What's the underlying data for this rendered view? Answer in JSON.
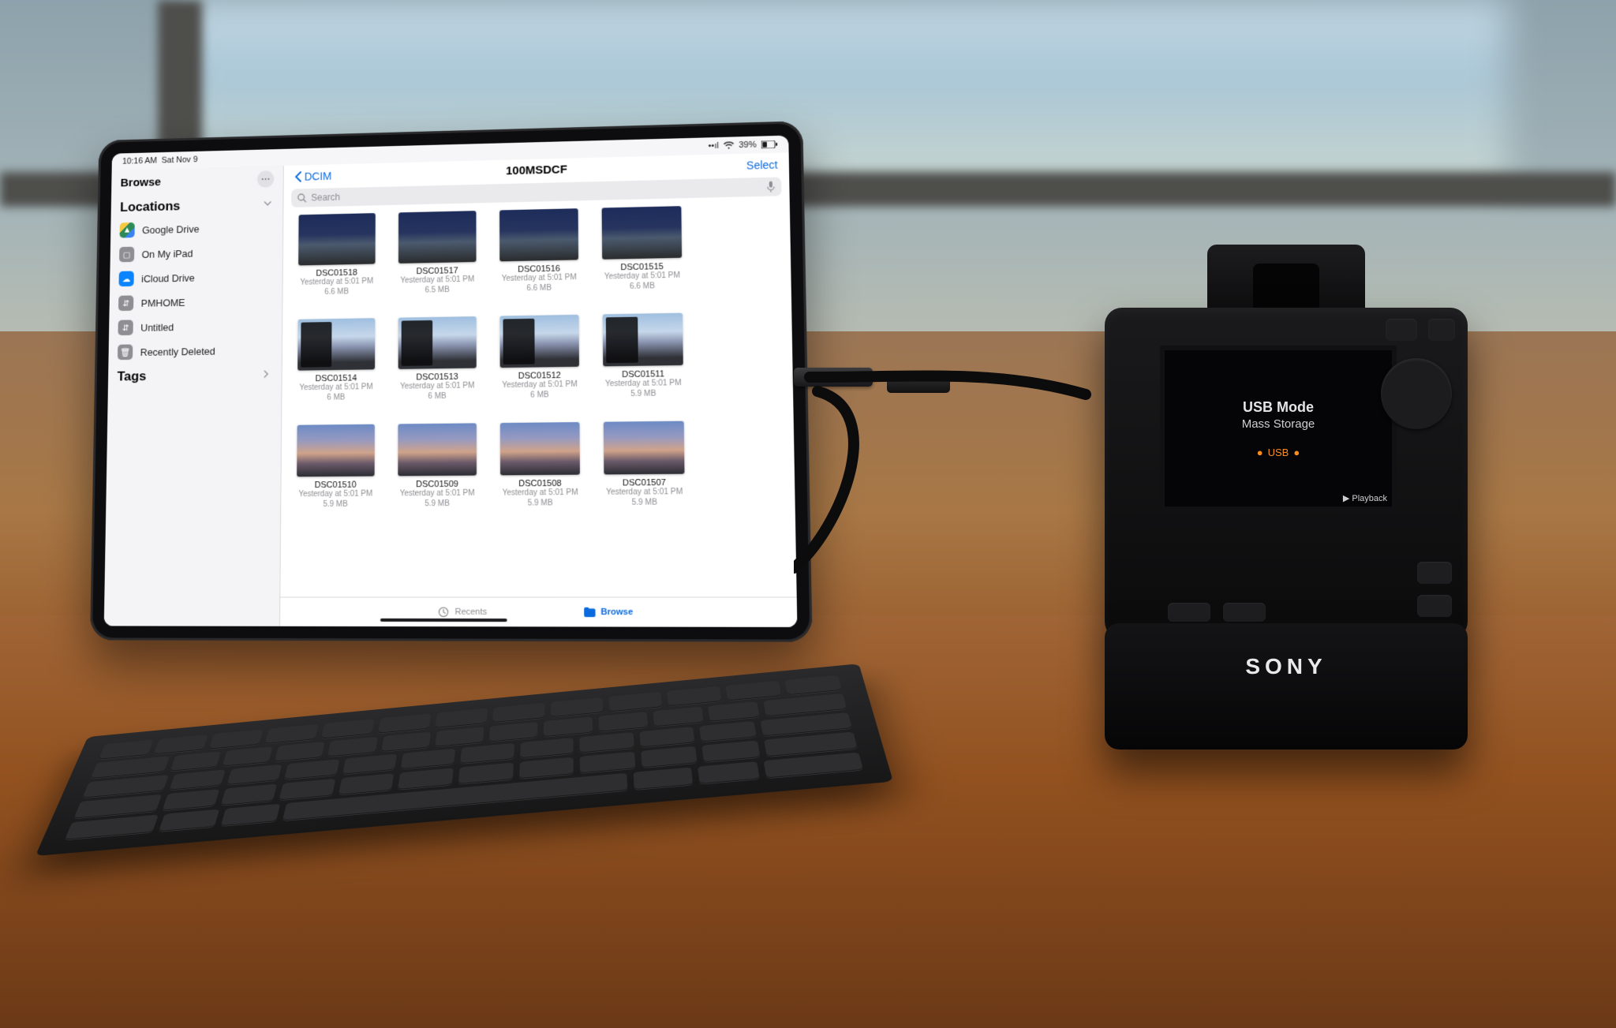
{
  "status": {
    "time": "10:16 AM",
    "date": "Sat Nov 9",
    "battery": "39%"
  },
  "sidebar": {
    "title": "Browse",
    "sections": {
      "locations": {
        "label": "Locations",
        "items": [
          {
            "label": "Google Drive"
          },
          {
            "label": "On My iPad"
          },
          {
            "label": "iCloud Drive"
          },
          {
            "label": "PMHOME"
          },
          {
            "label": "Untitled"
          },
          {
            "label": "Recently Deleted"
          }
        ]
      },
      "tags": {
        "label": "Tags"
      }
    }
  },
  "content": {
    "back_label": "DCIM",
    "title": "100MSDCF",
    "select_label": "Select",
    "search_placeholder": "Search"
  },
  "files": [
    {
      "name": "DSC01518",
      "meta1": "Yesterday at 5:01 PM",
      "meta2": "6.6 MB",
      "look": "dusk"
    },
    {
      "name": "DSC01517",
      "meta1": "Yesterday at 5:01 PM",
      "meta2": "6.5 MB",
      "look": "dusk"
    },
    {
      "name": "DSC01516",
      "meta1": "Yesterday at 5:01 PM",
      "meta2": "6.6 MB",
      "look": "dusk"
    },
    {
      "name": "DSC01515",
      "meta1": "Yesterday at 5:01 PM",
      "meta2": "6.6 MB",
      "look": "dusk"
    },
    {
      "name": "DSC01514",
      "meta1": "Yesterday at 5:01 PM",
      "meta2": "6 MB",
      "look": "dawn"
    },
    {
      "name": "DSC01513",
      "meta1": "Yesterday at 5:01 PM",
      "meta2": "6 MB",
      "look": "dawn"
    },
    {
      "name": "DSC01512",
      "meta1": "Yesterday at 5:01 PM",
      "meta2": "6 MB",
      "look": "dawn"
    },
    {
      "name": "DSC01511",
      "meta1": "Yesterday at 5:01 PM",
      "meta2": "5.9 MB",
      "look": "dawn"
    },
    {
      "name": "DSC01510",
      "meta1": "Yesterday at 5:01 PM",
      "meta2": "5.9 MB",
      "look": "eve"
    },
    {
      "name": "DSC01509",
      "meta1": "Yesterday at 5:01 PM",
      "meta2": "5.9 MB",
      "look": "eve"
    },
    {
      "name": "DSC01508",
      "meta1": "Yesterday at 5:01 PM",
      "meta2": "5.9 MB",
      "look": "eve"
    },
    {
      "name": "DSC01507",
      "meta1": "Yesterday at 5:01 PM",
      "meta2": "5.9 MB",
      "look": "eve"
    }
  ],
  "bottombar": {
    "recents": "Recents",
    "browse": "Browse"
  },
  "camera": {
    "brand": "SONY",
    "lcd_title": "USB Mode",
    "lcd_sub": "Mass Storage",
    "lcd_conn": "USB",
    "lcd_play": "▶ Playback"
  }
}
